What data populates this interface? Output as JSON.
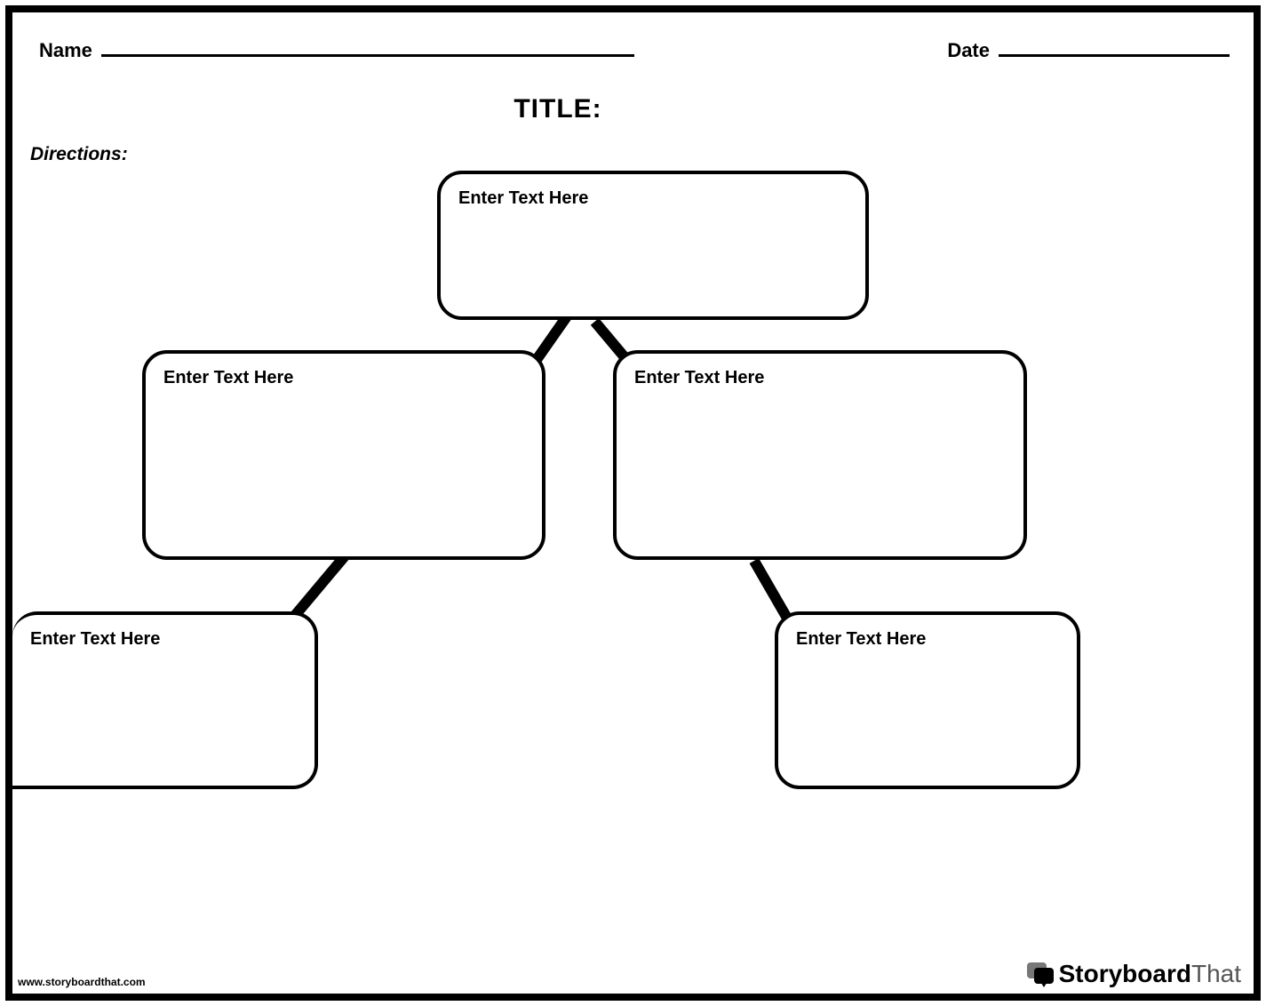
{
  "header": {
    "name_label": "Name",
    "date_label": "Date"
  },
  "title": "TITLE:",
  "directions_label": "Directions:",
  "boxes": {
    "b1": "Enter Text Here",
    "b2": "Enter Text Here",
    "b3": "Enter Text Here",
    "b4": "Enter Text Here",
    "b5": "Enter Text Here"
  },
  "footer": {
    "url": "www.storyboardthat.com",
    "logo_bold": "Storyboard",
    "logo_thin": "That"
  }
}
